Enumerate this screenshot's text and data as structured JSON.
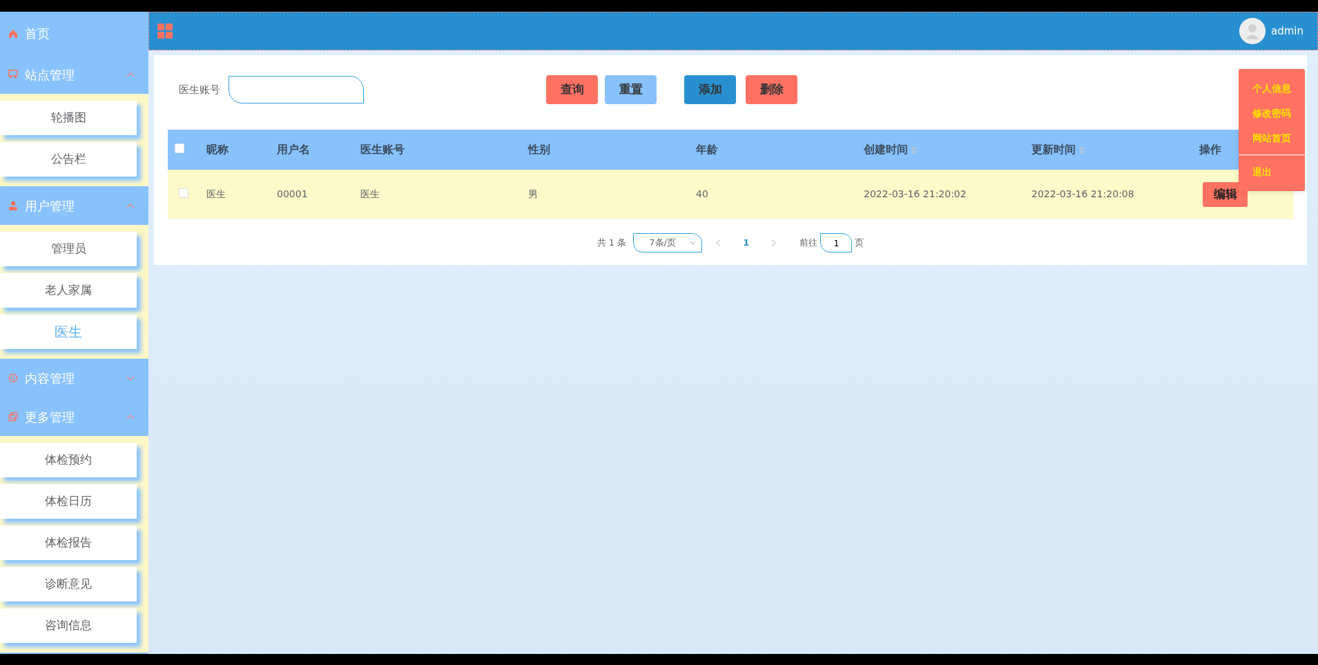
{
  "sidebar": {
    "items": [
      {
        "label": "首页"
      },
      {
        "label": "站点管理",
        "expanded": true,
        "children": [
          {
            "label": "轮播图",
            "selected": false
          },
          {
            "label": "公告栏",
            "selected": false
          }
        ]
      },
      {
        "label": "用户管理",
        "expanded": true,
        "children": [
          {
            "label": "管理员",
            "selected": false
          },
          {
            "label": "老人家属",
            "selected": false
          },
          {
            "label": "医生",
            "selected": true
          }
        ]
      },
      {
        "label": "内容管理",
        "expanded": false
      },
      {
        "label": "更多管理",
        "expanded": true,
        "children": [
          {
            "label": "体检预约",
            "selected": false
          },
          {
            "label": "体检日历",
            "selected": false
          },
          {
            "label": "体检报告",
            "selected": false
          },
          {
            "label": "诊断意见",
            "selected": false
          },
          {
            "label": "咨询信息",
            "selected": false
          }
        ]
      }
    ]
  },
  "header": {
    "user": "admin"
  },
  "user_menu": {
    "groups": [
      {
        "items": [
          "个人信息",
          "修改密码",
          "网站首页"
        ]
      },
      {
        "items": [
          "退出"
        ]
      }
    ]
  },
  "search": {
    "label": "医生账号",
    "buttons": [
      {
        "label": "查询",
        "color": "#ff7262"
      },
      {
        "label": "重置",
        "color": "#87c2fd"
      },
      {
        "label": "添加",
        "color": "#2890d0"
      },
      {
        "label": "删除",
        "color": "#ff7262"
      }
    ]
  },
  "table": {
    "header_checked": false,
    "columns": [
      {
        "label": "昵称",
        "sortable": false
      },
      {
        "label": "用户名",
        "sortable": false
      },
      {
        "label": "医生账号",
        "sortable": false
      },
      {
        "label": "性别",
        "sortable": false
      },
      {
        "label": "年龄",
        "sortable": false
      },
      {
        "label": "创建时间",
        "sortable": true
      },
      {
        "label": "更新时间",
        "sortable": true
      },
      {
        "label": "操作",
        "sortable": false
      }
    ],
    "rows": [
      {
        "selected": false,
        "cells": [
          "医生",
          "00001",
          "医生",
          "男",
          "40",
          "2022-03-16 21:20:02",
          "2022-03-16 21:20:08"
        ],
        "action": "编辑"
      }
    ]
  },
  "pagination": {
    "total": "共 1 条",
    "page_size": "7条/页",
    "prev": {
      "disabled": true
    },
    "pages": [
      {
        "label": "1",
        "selected": true
      }
    ],
    "next": {
      "disabled": true
    },
    "goto_label": "前往",
    "goto_value": "1",
    "goto_suffix": "页"
  }
}
